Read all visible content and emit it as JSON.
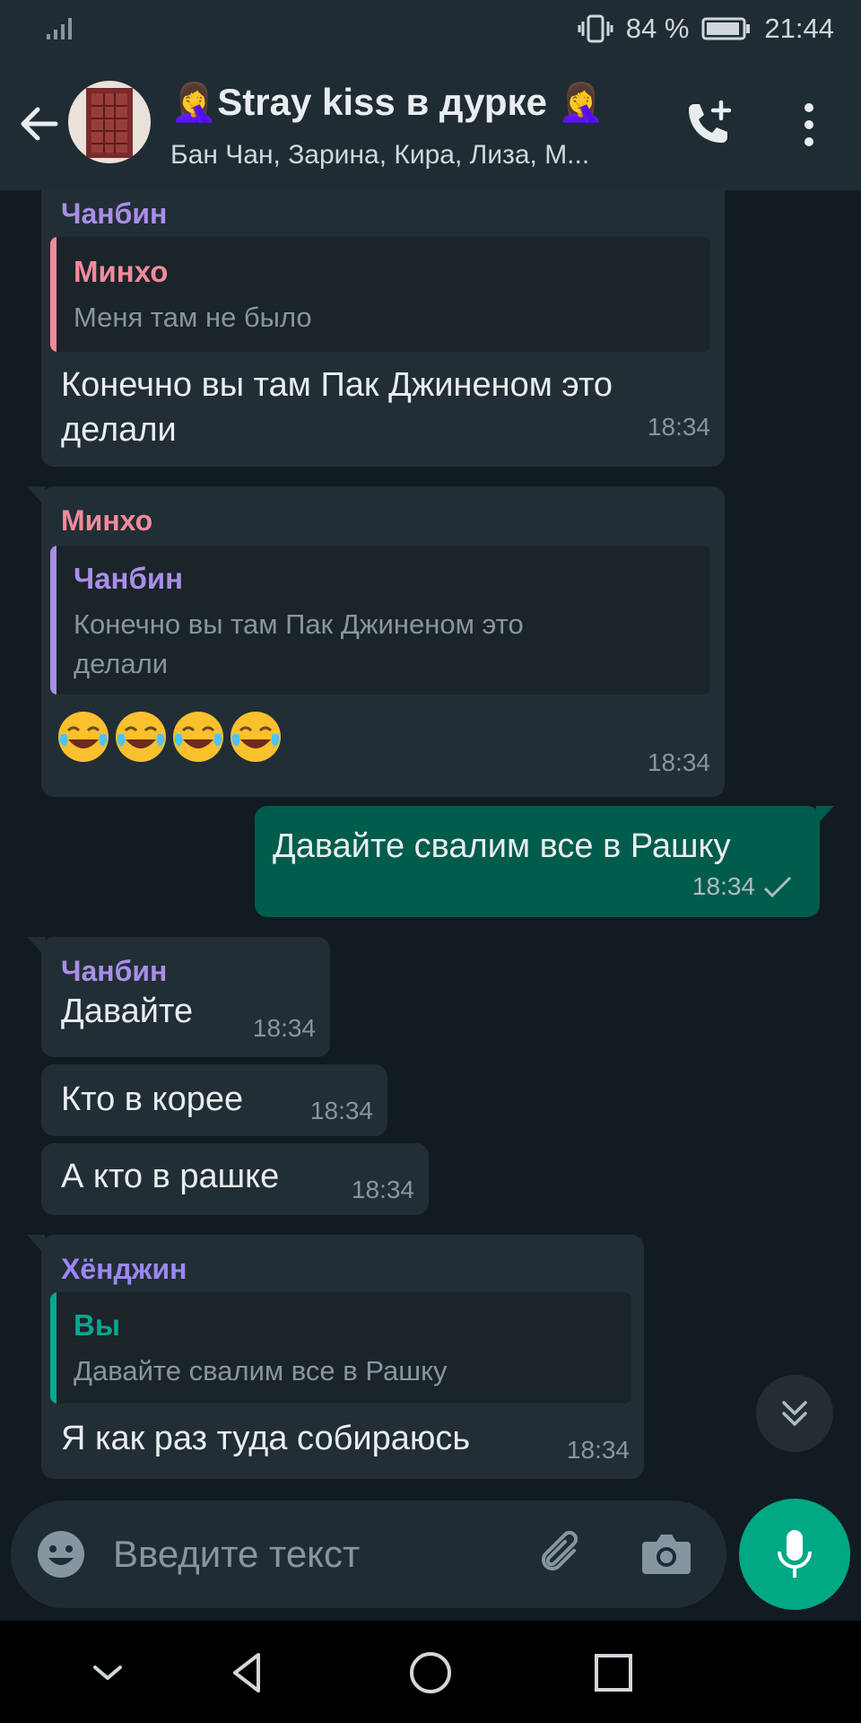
{
  "status_bar": {
    "battery": "84 %",
    "time": "21:44"
  },
  "header": {
    "title": "🤦‍♀️Stray kiss в дурке 🤦‍♀️",
    "subtitle": "Бан Чан, Зарина, Кира, Лиза, М..."
  },
  "colors": {
    "chanbin": "#a98ee8",
    "minho": "#f28b9c",
    "hyunjin": "#9b87f5",
    "you": "#06a88f",
    "incoming_bubble": "#222e35",
    "outgoing_bubble": "#005c4b",
    "accent": "#00a884"
  },
  "messages": [
    {
      "sender": "Чанбин",
      "quote_sender": "Минхо",
      "quote_text": "Меня там не было",
      "text": "Конечно вы там Пак Джиненом это\nделали",
      "time": "18:34"
    },
    {
      "sender": "Минхо",
      "quote_sender": "Чанбин",
      "quote_text": "Конечно вы там Пак Джиненом это\nделали",
      "text": "😂😂😂😂",
      "emoji_name": "face-with-tears-of-joy",
      "time": "18:34"
    },
    {
      "text": "Давайте свалим все в Рашку",
      "time": "18:34",
      "status_icon": "single-check-icon"
    },
    {
      "sender": "Чанбин",
      "text": "Давайте",
      "time": "18:34"
    },
    {
      "text": "Кто в корее",
      "time": "18:34"
    },
    {
      "text": "А кто в рашке",
      "time": "18:34"
    },
    {
      "sender": "Хёнджин",
      "quote_sender": "Вы",
      "quote_text": "Давайте свалим все в Рашку",
      "text": "Я как раз туда собираюсь",
      "time": "18:34"
    }
  ],
  "composer": {
    "placeholder": "Введите текст"
  }
}
